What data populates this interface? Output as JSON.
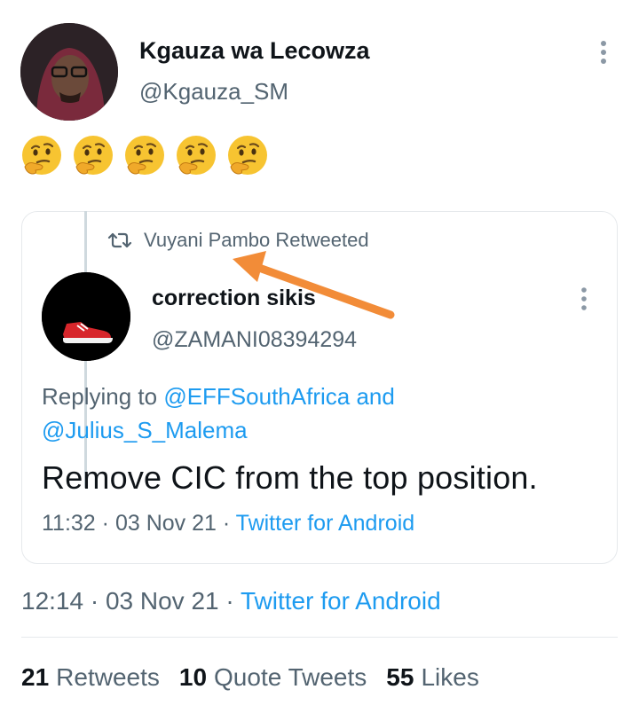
{
  "tweet": {
    "author_name": "Kgauza wa Lecowza",
    "author_handle": "@Kgauza_SM",
    "emoji_count": 5,
    "emoji_name": "thinking-face",
    "time": "12:14",
    "date": "03 Nov 21",
    "source": "Twitter for Android"
  },
  "quoted": {
    "retweeted_by": "Vuyani Pambo Retweeted",
    "author_name": "correction sikis",
    "author_handle": "@ZAMANI08394294",
    "replying_prefix": "Replying to",
    "reply_user1": "@EFFSouthAfrica",
    "reply_and": "and",
    "reply_user2": "@Julius_S_Malema",
    "text": "Remove CIC from the top position.",
    "time": "11:32",
    "date": "03 Nov 21",
    "source": "Twitter for Android"
  },
  "stats": {
    "retweets_count": "21",
    "retweets_label": "Retweets",
    "quotes_count": "10",
    "quotes_label": "Quote Tweets",
    "likes_count": "55",
    "likes_label": "Likes"
  },
  "separator": " · ",
  "colors": {
    "link": "#1d9bf0",
    "secondary_text": "#536471",
    "annotation_arrow": "#f28c38",
    "emoji_yellow": "#f7c431"
  }
}
